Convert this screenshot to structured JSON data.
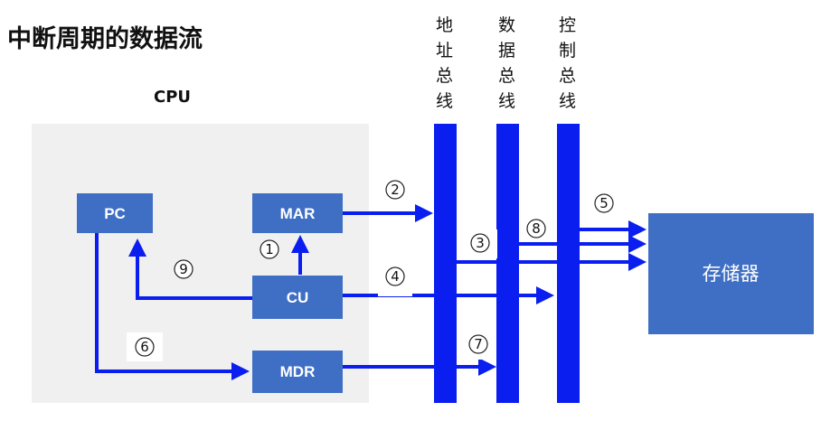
{
  "title": "中断周期的数据流",
  "cpu_label": "CPU",
  "registers": {
    "pc": "PC",
    "mar": "MAR",
    "cu": "CU",
    "mdr": "MDR"
  },
  "memory_label": "存储器",
  "buses": {
    "address": [
      "地",
      "址",
      "总",
      "线"
    ],
    "data": [
      "数",
      "据",
      "总",
      "线"
    ],
    "control": [
      "控",
      "制",
      "总",
      "线"
    ]
  },
  "steps": [
    "1",
    "2",
    "3",
    "4",
    "5",
    "6",
    "7",
    "8",
    "9"
  ],
  "colors": {
    "bus_blue": "#0a1ef0",
    "register_blue": "#3f6fc4",
    "cpu_background": "#f0f0f0"
  }
}
